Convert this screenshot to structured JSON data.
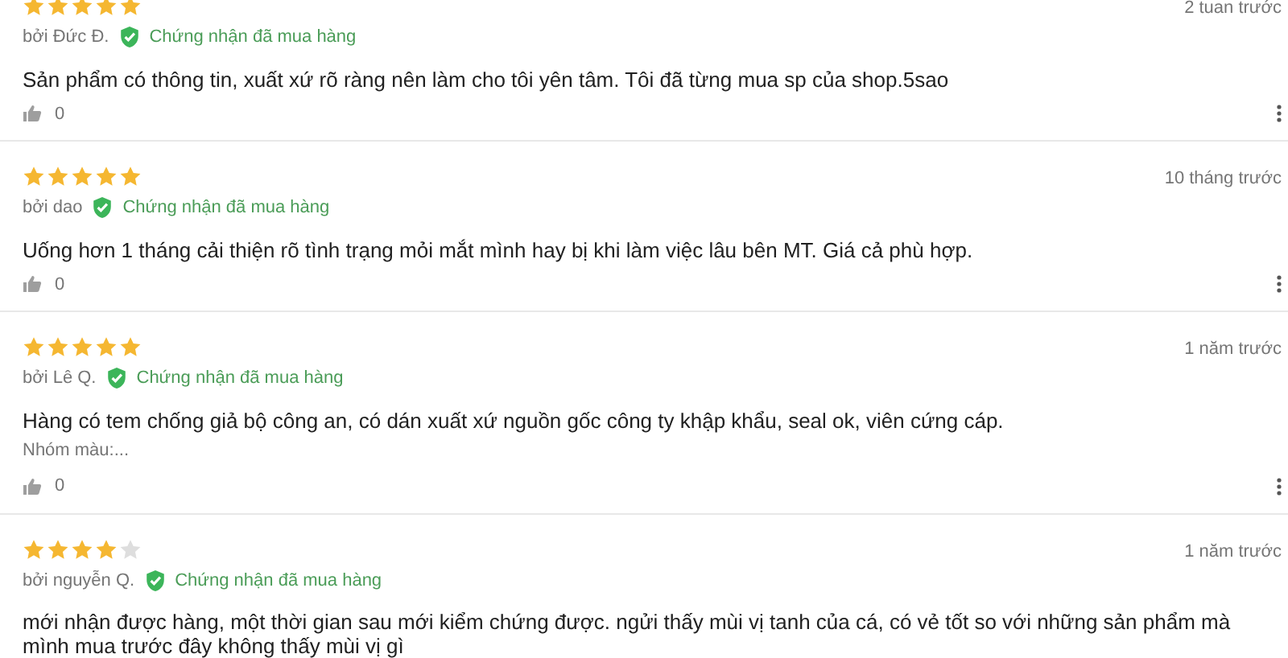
{
  "reviews": [
    {
      "stars": 5,
      "time": "2 tuan trước",
      "author": "bởi Đức Đ.",
      "verified": "Chứng nhận đã mua hàng",
      "text": "Sản phẩm có thông tin, xuất xứ rõ ràng nên làm cho tôi yên tâm. Tôi đã từng mua sp của shop.5sao",
      "likes": "0"
    },
    {
      "stars": 5,
      "time": "10 tháng trước",
      "author": "bởi dao",
      "verified": "Chứng nhận đã mua hàng",
      "text": "Uống hơn 1 tháng cải thiện rõ tình trạng mỏi mắt mình hay bị khi làm việc lâu bên MT. Giá cả phù hợp.",
      "likes": "0"
    },
    {
      "stars": 5,
      "time": "1 năm trước",
      "author": "bởi Lê Q.",
      "verified": "Chứng nhận đã mua hàng",
      "text": "Hàng có tem chống giả bộ công an, có dán xuất xứ nguồn gốc công ty  khập khẩu, seal ok, viên cứng cáp.",
      "variant": "Nhóm màu:...",
      "likes": "0"
    },
    {
      "stars": 4,
      "time": "1 năm trước",
      "author": "bởi nguyễn Q.",
      "verified": "Chứng nhận đã mua hàng",
      "text": "mới nhận được hàng, một thời gian sau mới kiểm chứng được. ngửi thấy mùi vị tanh của  cá, có vẻ tốt so với những  sản phẩm mà mình  mua trước đây không thấy mùi vị gì"
    }
  ]
}
